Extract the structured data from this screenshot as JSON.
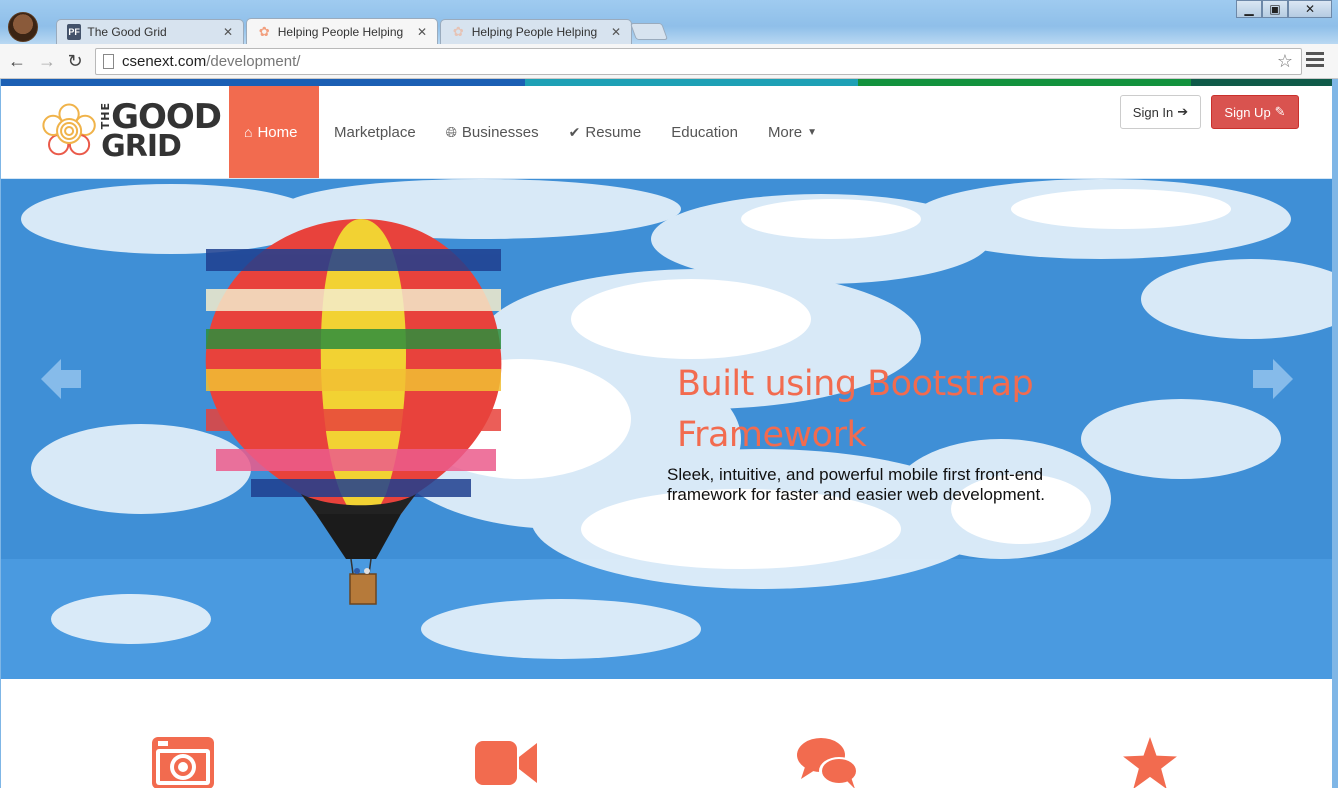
{
  "browser": {
    "tabs": [
      {
        "title": "The Good Grid",
        "favicon": "PF",
        "active": false
      },
      {
        "title": "Helping People Helping P",
        "favicon": "",
        "active": true
      },
      {
        "title": "Helping People Helping P",
        "favicon": "",
        "active": false
      }
    ],
    "url_host": "csenext.com",
    "url_path": "/development/"
  },
  "site": {
    "colorbar": [
      "#1b5fb4",
      "#1ea0b5",
      "#13923d",
      "#0f5a49"
    ],
    "logo": {
      "the": "THE",
      "good": "GOOD",
      "grid": "GRID"
    },
    "nav": [
      {
        "label": "Home",
        "icon": "home-icon",
        "active": true
      },
      {
        "label": "Marketplace",
        "icon": "",
        "active": false
      },
      {
        "label": "Businesses",
        "icon": "globe-icon",
        "active": false
      },
      {
        "label": "Resume",
        "icon": "check-icon",
        "active": false
      },
      {
        "label": "Education",
        "icon": "",
        "active": false
      },
      {
        "label": "More",
        "icon": "caret-down-icon",
        "active": false
      }
    ],
    "sign_in": "Sign In",
    "sign_up": "Sign Up",
    "accent": "#f26b4f"
  },
  "hero": {
    "title_line1": "Built using Bootstrap",
    "title_line2": "Framework",
    "text_line1": "Sleek, intuitive, and powerful mobile first front-end",
    "text_line2": "framework for faster and easier web development."
  },
  "features": [
    {
      "icon": "camera-icon"
    },
    {
      "icon": "video-camera-icon"
    },
    {
      "icon": "comments-icon"
    },
    {
      "icon": "star-icon"
    }
  ]
}
